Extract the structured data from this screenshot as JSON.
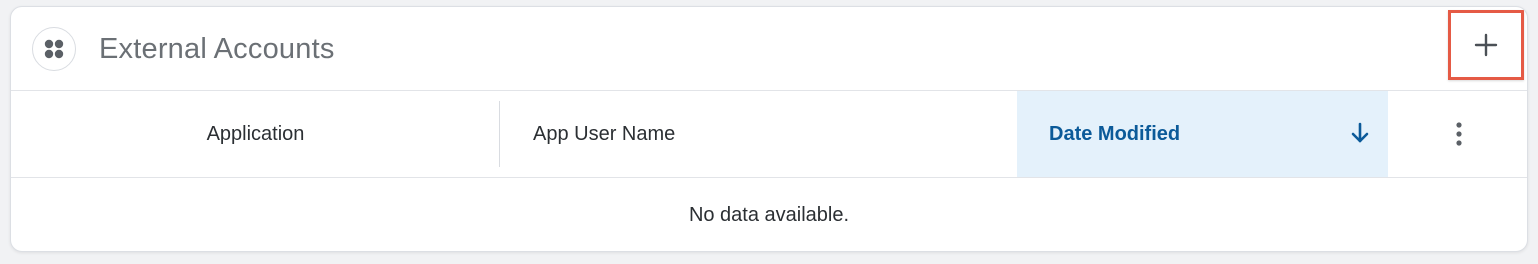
{
  "header": {
    "title": "External Accounts",
    "module_icon": "grid-dots-icon",
    "add_icon": "plus-icon"
  },
  "table": {
    "columns": [
      {
        "label": "Application"
      },
      {
        "label": "App User Name"
      },
      {
        "label": "Date Modified",
        "sorted": "descending",
        "sort_icon": "arrow-down-icon"
      }
    ],
    "actions_icon": "kebab-menu-icon",
    "empty_message": "No data available."
  },
  "colors": {
    "highlight_border": "#e55a45",
    "sorted_column_bg": "#e4f1fb",
    "sorted_column_text": "#0b5a99"
  }
}
